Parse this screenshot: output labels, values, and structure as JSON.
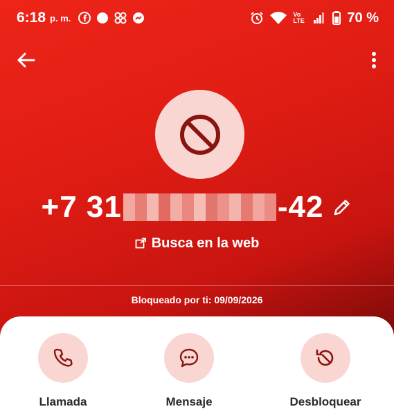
{
  "status_bar": {
    "time": "6:18",
    "ampm": "p. m.",
    "battery": "70 %",
    "network": "Vo LTE",
    "icons": [
      "facebook-icon",
      "circle-icon",
      "pinwheel-icon",
      "messenger-icon",
      "alarm-icon",
      "wifi-icon",
      "signal-icon",
      "battery-icon"
    ]
  },
  "contact": {
    "phone_prefix": "+7 31",
    "phone_suffix": "-42",
    "web_search": "Busca en la web",
    "blocked_info": "Bloqueado por ti: 09/09/2026"
  },
  "actions": [
    {
      "label": "Llamada",
      "icon": "phone-icon"
    },
    {
      "label": "Mensaje",
      "icon": "message-icon"
    },
    {
      "label": "Desbloquear",
      "icon": "unblock-icon"
    }
  ],
  "colors": {
    "hero_red": "#e01d14",
    "accent_pink": "#f9d6d2",
    "icon_dark_red": "#8a1410"
  }
}
